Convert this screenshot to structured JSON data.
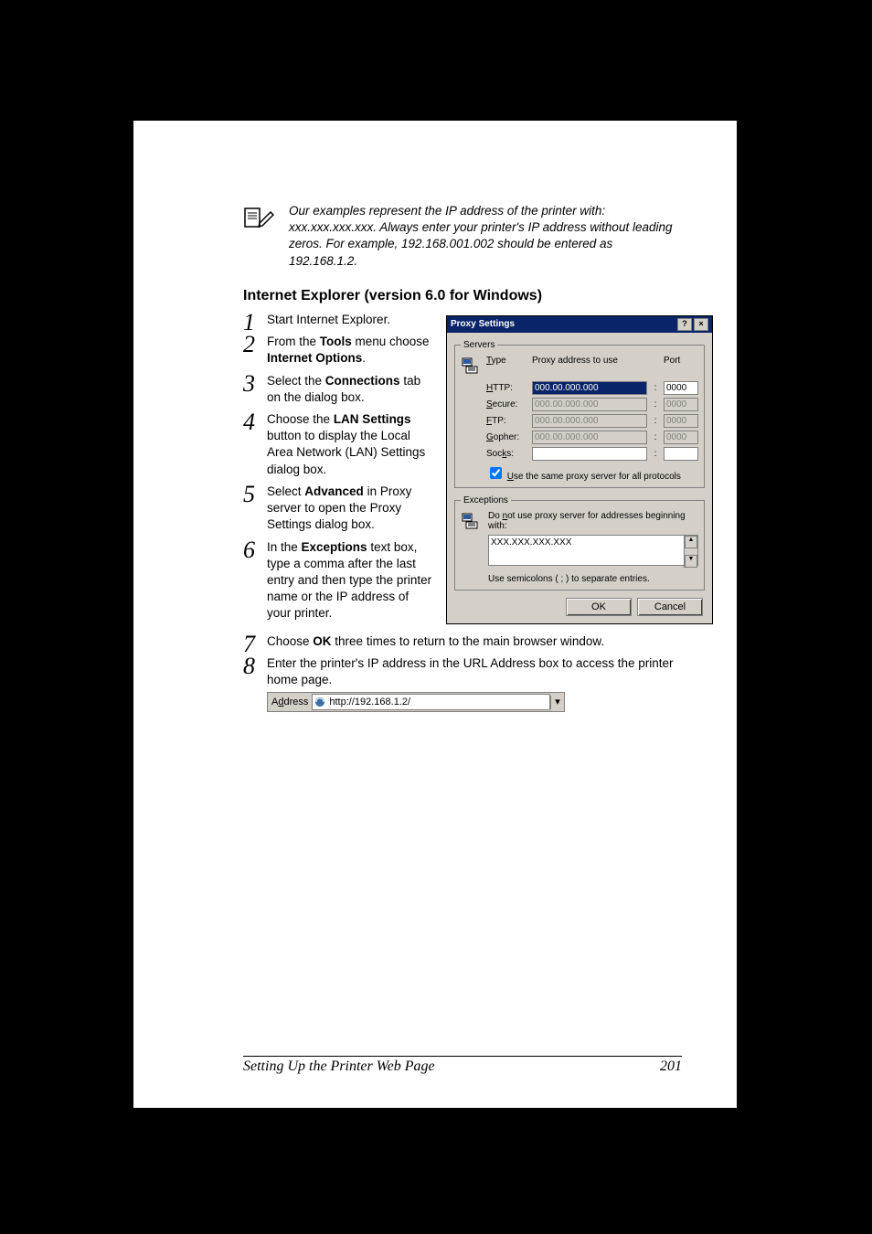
{
  "note": "Our examples represent the IP address of the printer with: xxx.xxx.xxx.xxx. Always enter your printer's IP address without leading zeros. For example, 192.168.001.002 should be entered as 192.168.1.2.",
  "heading": "Internet Explorer (version 6.0 for Windows)",
  "steps": {
    "s1": {
      "a": "Start Internet Explorer."
    },
    "s2": {
      "a": "From the ",
      "b": "Tools",
      "c": " menu choose ",
      "d": "Internet Options",
      "e": "."
    },
    "s3": {
      "a": "Select the ",
      "b": "Connections",
      "c": " tab on the dialog box."
    },
    "s4": {
      "a": "Choose the ",
      "b": "LAN Settings",
      "c": " button to display the Local Area Network (LAN) Settings dialog box."
    },
    "s5": {
      "a": "Select ",
      "b": "Advanced",
      "c": " in Proxy server to open the Proxy Settings dialog box."
    },
    "s6": {
      "a": "In the ",
      "b": "Exceptions",
      "c": " text box, type a comma after the last entry and then type the printer name or the IP address of your printer."
    },
    "s7": {
      "a": "Choose ",
      "b": "OK",
      "c": " three times to return to the main browser window."
    },
    "s8": {
      "a": "Enter the printer's IP address in the URL Address box to access the printer home page."
    }
  },
  "dialog": {
    "title": "Proxy Settings",
    "help_btn": "?",
    "close_btn": "×",
    "servers_legend": "Servers",
    "hdr_type": "Type",
    "hdr_addr": "Proxy address to use",
    "hdr_port": "Port",
    "rows": {
      "http": {
        "label": "HTTP:",
        "addr": "000.00.000.000",
        "port": "0000"
      },
      "secure": {
        "label": "Secure:",
        "addr": "000.00.000.000",
        "port": "0000"
      },
      "ftp": {
        "label": "FTP:",
        "addr": "000.00.000.000",
        "port": "0000"
      },
      "gopher": {
        "label": "Gopher:",
        "addr": "000.00.000.000",
        "port": "0000"
      },
      "socks": {
        "label": "Socks:",
        "addr": "",
        "port": ""
      }
    },
    "same_proxy": "Use the same proxy server for all protocols",
    "exceptions_legend": "Exceptions",
    "exceptions_text": "Do not use proxy server for addresses beginning with:",
    "exceptions_value": "XXX.XXX.XXX.XXX",
    "separator_hint": "Use semicolons ( ; ) to separate entries.",
    "ok": "OK",
    "cancel": "Cancel"
  },
  "address_bar": {
    "label_pre": "A",
    "label_underline": "d",
    "label_post": "dress",
    "value": "http://192.168.1.2/",
    "dropdown": "▾"
  },
  "footer": {
    "left": "Setting Up the Printer Web Page",
    "right": "201"
  }
}
